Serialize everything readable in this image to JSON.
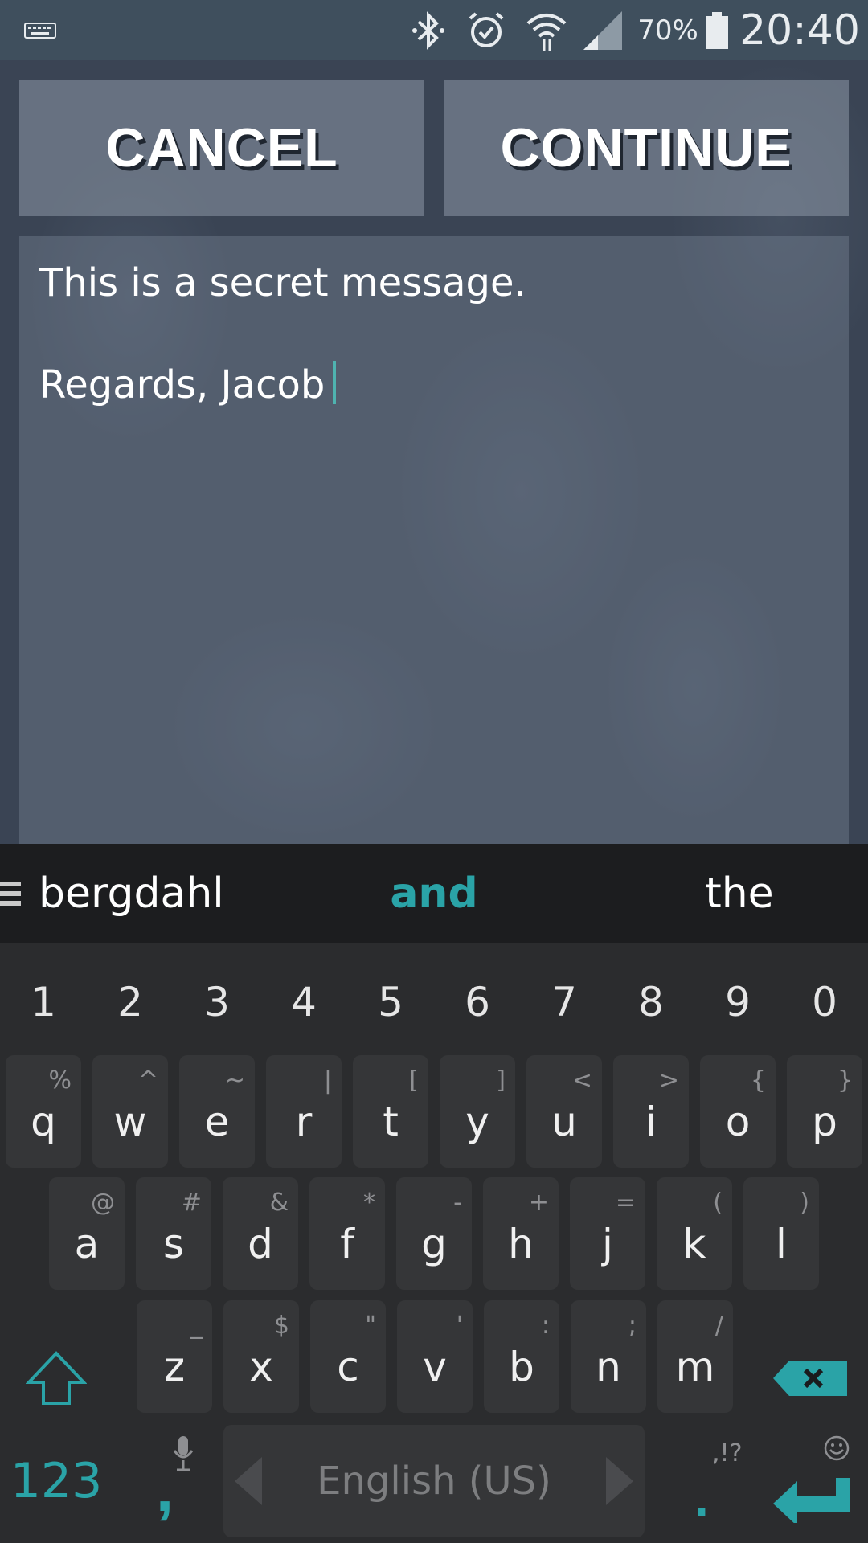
{
  "status_bar": {
    "time": "20:40",
    "battery_percent": "70%",
    "icons": [
      "keyboard-icon",
      "bluetooth-icon",
      "alarm-icon",
      "wifi-icon",
      "signal-icon",
      "battery-icon"
    ]
  },
  "actions": {
    "cancel_label": "CANCEL",
    "continue_label": "CONTINUE"
  },
  "message": {
    "line1": "This is a secret message.",
    "line2": "Regards, Jacob"
  },
  "suggestions": {
    "left": "bergdahl",
    "center": "and",
    "right": "the"
  },
  "keyboard": {
    "numbers": [
      "1",
      "2",
      "3",
      "4",
      "5",
      "6",
      "7",
      "8",
      "9",
      "0"
    ],
    "row1": [
      {
        "k": "q",
        "h": "%"
      },
      {
        "k": "w",
        "h": "^"
      },
      {
        "k": "e",
        "h": "~"
      },
      {
        "k": "r",
        "h": "|"
      },
      {
        "k": "t",
        "h": "["
      },
      {
        "k": "y",
        "h": "]"
      },
      {
        "k": "u",
        "h": "<"
      },
      {
        "k": "i",
        "h": ">"
      },
      {
        "k": "o",
        "h": "{"
      },
      {
        "k": "p",
        "h": "}"
      }
    ],
    "row2": [
      {
        "k": "a",
        "h": "@"
      },
      {
        "k": "s",
        "h": "#"
      },
      {
        "k": "d",
        "h": "&"
      },
      {
        "k": "f",
        "h": "*"
      },
      {
        "k": "g",
        "h": "-"
      },
      {
        "k": "h",
        "h": "+"
      },
      {
        "k": "j",
        "h": "="
      },
      {
        "k": "k",
        "h": "("
      },
      {
        "k": "l",
        "h": ")"
      }
    ],
    "row3": [
      {
        "k": "z",
        "h": "_"
      },
      {
        "k": "x",
        "h": "$"
      },
      {
        "k": "c",
        "h": "\""
      },
      {
        "k": "v",
        "h": "'"
      },
      {
        "k": "b",
        "h": ":"
      },
      {
        "k": "n",
        "h": ";"
      },
      {
        "k": "m",
        "h": "/"
      }
    ],
    "symbols_label": "123",
    "comma_label": ",",
    "space_label": "English (US)",
    "period_label": ".",
    "period_hint": ",!?",
    "accent_color": "#2aa3a7"
  }
}
